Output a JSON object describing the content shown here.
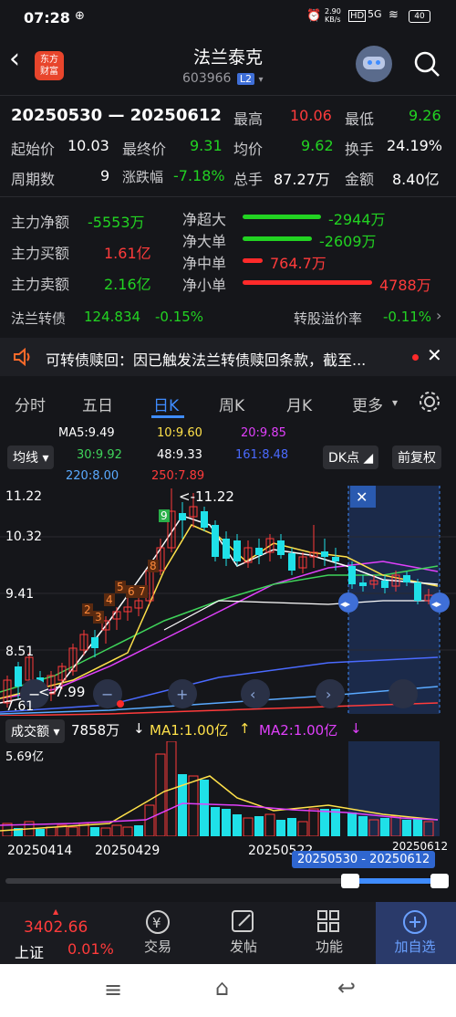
{
  "status": {
    "time": "07:28",
    "net_speed": "2.90 KB/s",
    "net_type": "5G",
    "battery": "40"
  },
  "header": {
    "title": "法兰泰克",
    "code": "603966",
    "level": "L2",
    "logo_line1": "东方",
    "logo_line2": "财富"
  },
  "summary": {
    "range": "20250530 — 20250612",
    "high_label": "最高",
    "high": "10.06",
    "low_label": "最低",
    "low": "9.26",
    "start_label": "起始价",
    "start": "10.03",
    "end_label": "最终价",
    "end": "9.31",
    "avg_label": "均价",
    "avg": "9.62",
    "turnover_label": "换手",
    "turnover": "24.19%",
    "period_label": "周期数",
    "period": "9",
    "chg_label": "涨跌幅",
    "chg": "-7.18%",
    "vol_label": "总手",
    "vol": "87.27万",
    "amount_label": "金额",
    "amount": "8.40亿"
  },
  "flow": {
    "net_label": "主力净额",
    "net": "-5553万",
    "buy_label": "主力买额",
    "buy": "1.61亿",
    "sell_label": "主力卖额",
    "sell": "2.16亿",
    "super_label": "净超大",
    "super": "-2944万",
    "large_label": "净大单",
    "large": "-2609万",
    "mid_label": "净中单",
    "mid": "764.7万",
    "small_label": "净小单",
    "small": "4788万"
  },
  "bond": {
    "name": "法兰转债",
    "price": "124.834",
    "chg": "-0.15%",
    "premium_label": "转股溢价率",
    "premium": "-0.11%"
  },
  "notice": {
    "text": "可转债赎回：因已触发法兰转债赎回条款，截至..."
  },
  "tabs": [
    "分时",
    "五日",
    "日K",
    "周K",
    "月K",
    "更多"
  ],
  "ma": {
    "ma5": "MA5:9.49",
    "ma10": "10:9.60",
    "ma20": "20:9.85",
    "ma30": "30:9.92",
    "ma48": "48:9.33",
    "ma161": "161:8.48",
    "ma220": "220:8.00",
    "ma250": "250:7.89",
    "indicator": "均线",
    "dk": "DK点",
    "adjust": "前复权"
  },
  "price_axis": [
    "11.22",
    "10.32",
    "9.41",
    "8.51",
    "7.61"
  ],
  "price_marks": {
    "high": "<-11.22",
    "low": "<-7.99"
  },
  "td_counts": [
    "2",
    "3",
    "4",
    "5",
    "6",
    "7",
    "8",
    "9"
  ],
  "volume": {
    "label": "成交额",
    "value": "7858万",
    "ma1": "MA1:1.00亿",
    "ma2": "MA2:1.00亿",
    "axis_top": "5.69亿"
  },
  "dates": [
    "20250414",
    "20250429",
    "20250522",
    "20250612"
  ],
  "range_label": "20250530 - 20250612",
  "index": {
    "value": "3402.66",
    "name": "上证",
    "chg": "0.01%"
  },
  "nav": [
    "交易",
    "发帖",
    "功能",
    "加自选"
  ],
  "colors": {
    "up": "#ff3b3b",
    "down": "#22d322",
    "accent": "#3f8cff",
    "bg": "#15161a"
  }
}
